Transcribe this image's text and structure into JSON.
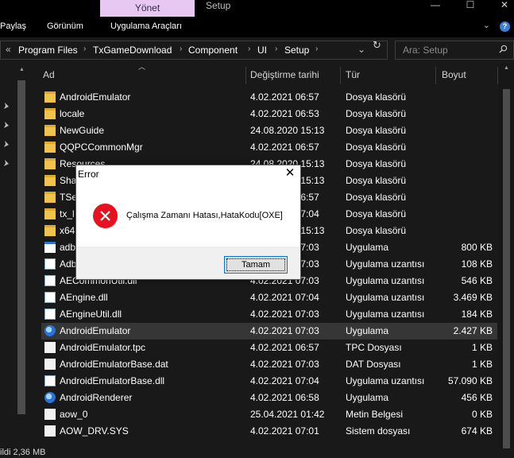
{
  "titlebar": {
    "context_tab": "Yönet",
    "title": "Setup",
    "minimize": "—",
    "maximize": "☐",
    "close": "✕"
  },
  "ribbon": {
    "tabs": [
      "Paylaş",
      "Görünüm",
      "Uygulama Araçları"
    ],
    "collapse": "⌄",
    "help": "?"
  },
  "address": {
    "back_glyph": "«",
    "crumbs": [
      "Program Files",
      "TxGameDownload",
      "Component",
      "UI",
      "Setup"
    ],
    "dropdown": "⌄",
    "refresh": "↻",
    "search_placeholder": "Ara: Setup"
  },
  "columns": {
    "name": "Ad",
    "date": "Değiştirme tarihi",
    "type": "Tür",
    "size": "Boyut"
  },
  "rows": [
    {
      "name": "AndroidEmulator",
      "date": "4.02.2021 06:57",
      "type": "Dosya klasörü",
      "size": "",
      "icon": "folder"
    },
    {
      "name": "locale",
      "date": "4.02.2021 06:53",
      "type": "Dosya klasörü",
      "size": "",
      "icon": "folder"
    },
    {
      "name": "NewGuide",
      "date": "24.08.2020 15:13",
      "type": "Dosya klasörü",
      "size": "",
      "icon": "folder"
    },
    {
      "name": "QQPCCommonMgr",
      "date": "4.02.2021 06:57",
      "type": "Dosya klasörü",
      "size": "",
      "icon": "folder"
    },
    {
      "name": "Resources",
      "date": "24.08.2020 15:13",
      "type": "Dosya klasörü",
      "size": "",
      "icon": "folder"
    },
    {
      "name": "Sha",
      "date": "24.08.2020 15:13",
      "type": "Dosya klasörü",
      "size": "",
      "icon": "folder"
    },
    {
      "name": "TSe",
      "date": "4.02.2021 06:57",
      "type": "Dosya klasörü",
      "size": "",
      "icon": "folder"
    },
    {
      "name": "tx_l",
      "date": "4.02.2021 07:04",
      "type": "Dosya klasörü",
      "size": "",
      "icon": "folder"
    },
    {
      "name": "x64",
      "date": "24.08.2020 15:13",
      "type": "Dosya klasörü",
      "size": "",
      "icon": "folder"
    },
    {
      "name": "adb",
      "date": "4.02.2021 07:03",
      "type": "Uygulama",
      "size": "800 KB",
      "icon": "app"
    },
    {
      "name": "Adb",
      "date": "4.02.2021 07:03",
      "type": "Uygulama uzantısı",
      "size": "108 KB",
      "icon": "gear"
    },
    {
      "name": "AECommonUtil.dll",
      "date": "4.02.2021 07:03",
      "type": "Uygulama uzantısı",
      "size": "546 KB",
      "icon": "gear"
    },
    {
      "name": "AEngine.dll",
      "date": "4.02.2021 07:04",
      "type": "Uygulama uzantısı",
      "size": "3.469 KB",
      "icon": "gear"
    },
    {
      "name": "AEngineUtil.dll",
      "date": "4.02.2021 07:03",
      "type": "Uygulama uzantısı",
      "size": "184 KB",
      "icon": "gear"
    },
    {
      "name": "AndroidEmulator",
      "date": "4.02.2021 07:03",
      "type": "Uygulama",
      "size": "2.427 KB",
      "icon": "globe",
      "selected": true
    },
    {
      "name": "AndroidEmulator.tpc",
      "date": "4.02.2021 06:57",
      "type": "TPC Dosyası",
      "size": "1 KB",
      "icon": "doc"
    },
    {
      "name": "AndroidEmulatorBase.dat",
      "date": "4.02.2021 07:03",
      "type": "DAT Dosyası",
      "size": "1 KB",
      "icon": "doc"
    },
    {
      "name": "AndroidEmulatorBase.dll",
      "date": "4.02.2021 07:04",
      "type": "Uygulama uzantısı",
      "size": "57.090 KB",
      "icon": "gear"
    },
    {
      "name": "AndroidRenderer",
      "date": "4.02.2021 06:58",
      "type": "Uygulama",
      "size": "456 KB",
      "icon": "globe"
    },
    {
      "name": "aow_0",
      "date": "25.04.2021 01:42",
      "type": "Metin Belgesi",
      "size": "0 KB",
      "icon": "doc"
    },
    {
      "name": "AOW_DRV.SYS",
      "date": "4.02.2021 07:01",
      "type": "Sistem dosyası",
      "size": "674 KB",
      "icon": "doc"
    }
  ],
  "status": {
    "text": "ildi  2,36 MB"
  },
  "dialog": {
    "title": "Error",
    "close": "✕",
    "message": "Çalışma Zamanı Hatası,HataKodu[OXE]",
    "button": "Tamam"
  },
  "colors": {
    "background": "#191919",
    "context_tab": "#e6c8f2",
    "selection": "#363636",
    "folder": "#f0c44c",
    "error_icon": "#e8111f",
    "button_border": "#0078d7"
  }
}
